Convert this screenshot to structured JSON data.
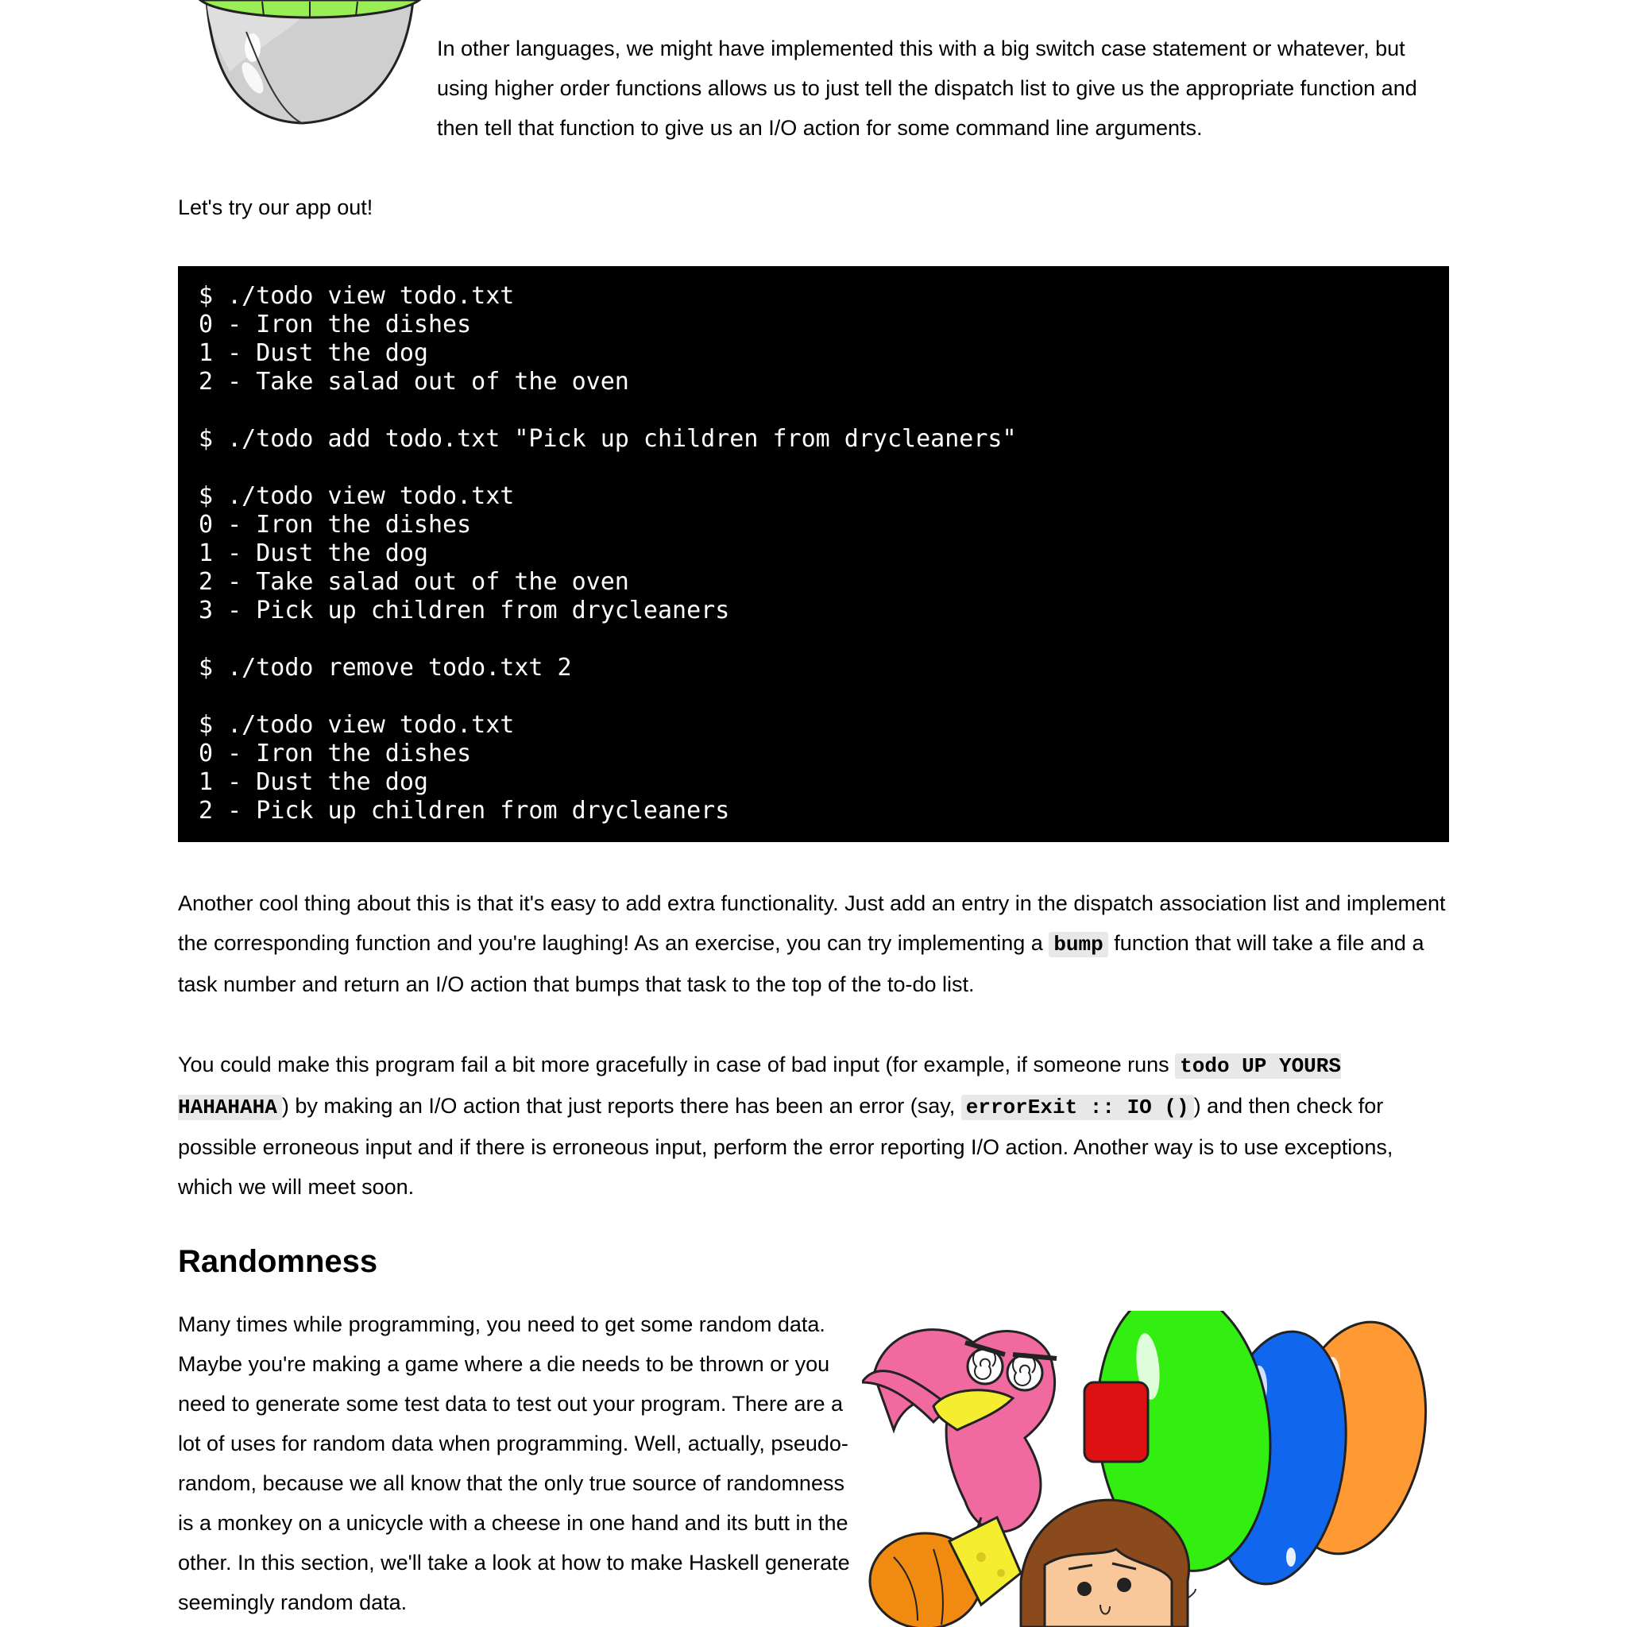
{
  "intro": {
    "text": "In other languages, we might have implemented this with a big switch case statement or whatever, but using higher order functions allows us to just tell the dispatch list to give us the appropriate function and then tell that function to give us an I/O action for some command line arguments."
  },
  "try_it": "Let's try our app out!",
  "terminal_lines": [
    "$ ./todo view todo.txt",
    "0 - Iron the dishes",
    "1 - Dust the dog",
    "2 - Take salad out of the oven",
    "",
    "$ ./todo add todo.txt \"Pick up children from drycleaners\"",
    "",
    "$ ./todo view todo.txt",
    "0 - Iron the dishes",
    "1 - Dust the dog",
    "2 - Take salad out of the oven",
    "3 - Pick up children from drycleaners",
    "",
    "$ ./todo remove todo.txt 2",
    "",
    "$ ./todo view todo.txt",
    "0 - Iron the dishes",
    "1 - Dust the dog",
    "2 - Pick up children from drycleaners"
  ],
  "cool": {
    "part1": "Another cool thing about this is that it's easy to add extra functionality. Just add an entry in the dispatch association list and implement the corresponding function and you're laughing! As an exercise, you can try implementing a ",
    "code": "bump",
    "part2": " function that will take a file and a task number and return an I/O action that bumps that task to the top of the to-do list."
  },
  "could": {
    "part1": "You could make this program fail a bit more gracefully in case of bad input (for example, if someone runs ",
    "code1": "todo UP YOURS HAHAHAHA",
    "part2": ") by making an I/O action that just reports there has been an error (say, ",
    "code2": "errorExit :: IO ()",
    "part3": ") and then check for possible erroneous input and if there is erroneous input, perform the error reporting I/O action. Another way is to use exceptions, which we will meet soon."
  },
  "section": {
    "heading": "Randomness",
    "text": "Many times while programming, you need to get some random data. Maybe you're making a game where a die needs to be thrown or you need to generate some test data to test out your program. There are a lot of uses for random data when programming. Well, actually, pseudo-random, because we all know that the only true source of randomness is a monkey on a unicycle with a cheese in one hand and its butt in the other. In this section, we'll take a look at how to make Haskell generate seemingly random data."
  },
  "colors": {
    "terminal_bg": "#000000",
    "terminal_fg": "#ffffff",
    "inline_code_bg": "#e8e8e8",
    "balloon_green": "#33ee11",
    "balloon_blue": "#1166ee",
    "balloon_orange": "#ff9933",
    "bird_pink": "#f06aa0",
    "beak_yellow": "#f5ee30",
    "hair_brown": "#8b4a1c",
    "skin": "#f8c89a"
  }
}
